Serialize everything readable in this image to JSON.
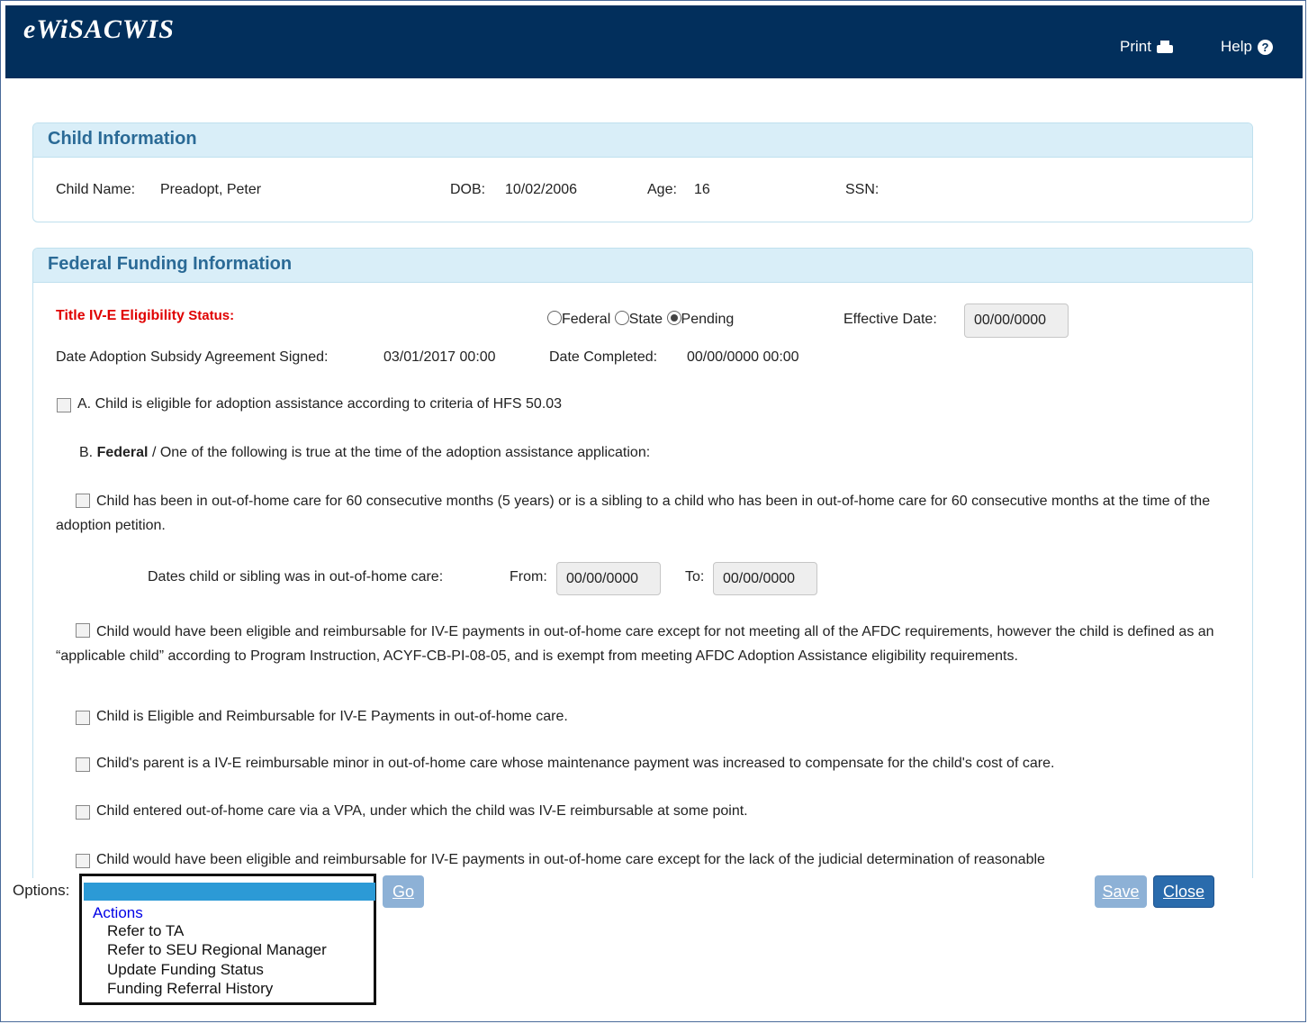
{
  "app": {
    "title": "eWiSACWIS",
    "print_label": "Print",
    "help_label": "Help"
  },
  "child_info": {
    "heading": "Child Information",
    "name_label": "Child Name:",
    "name_value": "Preadopt, Peter",
    "dob_label": "DOB:",
    "dob_value": "10/02/2006",
    "age_label": "Age:",
    "age_value": "16",
    "ssn_label": "SSN:",
    "ssn_value": ""
  },
  "federal": {
    "heading": "Federal Funding Information",
    "eligibility_label": "Title IV-E Eligibility",
    "status_label": "Status:",
    "status_options": [
      "Federal",
      "State",
      "Pending"
    ],
    "status_selected": "Pending",
    "effective_date_label": "Effective Date:",
    "effective_date_value": "00/00/0000",
    "agreement_signed_label": "Date Adoption Subsidy Agreement Signed:",
    "agreement_signed_value": "03/01/2017 00:00",
    "completed_label": "Date Completed:",
    "completed_value": "00/00/0000 00:00",
    "criterion_a": "A. Child is eligible for adoption assistance according to criteria of HFS 50.03",
    "criterion_b_prefix": "B.",
    "criterion_b_bold": "Federal",
    "criterion_b_rest": " / One of the following is true at the time of the adoption assistance application:",
    "item_60_months": "Child has been in out-of-home care for 60 consecutive months (5 years) or is a sibling to a child who has been in out-of-home care for 60 consecutive months at the time of the adoption petition.",
    "dates_label": "Dates child or sibling was in out-of-home care:",
    "from_label": "From:",
    "from_value": "00/00/0000",
    "to_label": "To:",
    "to_value": "00/00/0000",
    "item_afdc": "Child would have been eligible and reimbursable for IV-E payments in out-of-home care except for not meeting all of the AFDC requirements, however the child is defined as an “applicable child” according to Program Instruction, ACYF-CB-PI-08-05, and is exempt from meeting AFDC Adoption Assistance eligibility requirements.",
    "item_eligible": "Child is Eligible and Reimbursable for IV-E Payments in out-of-home care.",
    "item_parent_minor": "Child's parent is a IV-E reimbursable minor in out-of-home care whose maintenance payment was increased to compensate for the child's cost of care.",
    "item_vpa": "Child entered out-of-home care via a VPA, under which the child was IV-E reimbursable at some point.",
    "item_judicial": "Child would have been eligible and reimbursable for IV-E payments in out-of-home care except for the lack of the judicial determination of reasonable"
  },
  "footer": {
    "options_label": "Options:",
    "options_selected": "",
    "options_group": "Actions",
    "options_items": [
      "Refer to TA",
      "Refer to SEU Regional Manager",
      "Update Funding Status",
      "Funding Referral History"
    ],
    "go_label": "Go",
    "save_label": "Save",
    "close_label": "Close"
  },
  "colors": {
    "header_bg": "#022f5c",
    "panel_head_bg": "#d9eef8",
    "panel_title": "#2a6a96",
    "required_red": "#e00000",
    "button_primary": "#2a6bac",
    "button_disabled": "#8db1d6"
  }
}
